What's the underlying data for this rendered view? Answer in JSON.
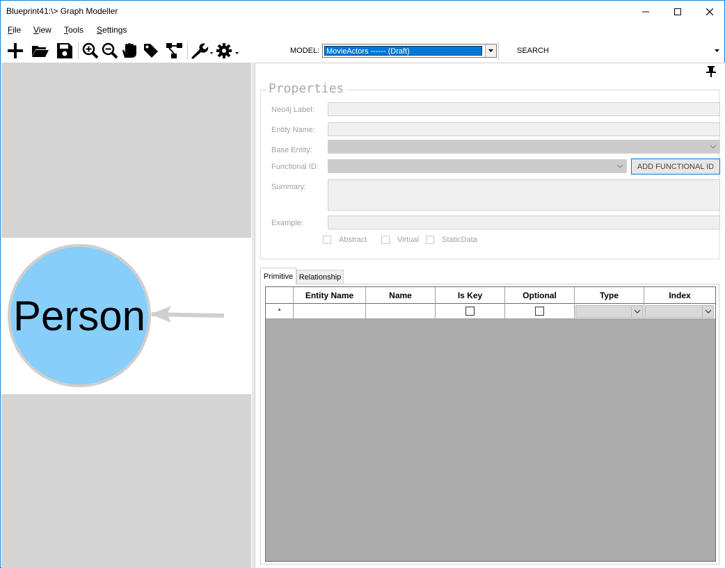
{
  "window": {
    "title": "Blueprint41:\\> Graph Modeller"
  },
  "menu": {
    "items": [
      "File",
      "View",
      "Tools",
      "Settings"
    ]
  },
  "toolbar": {
    "buttons": [
      "add-icon",
      "open-folder-icon",
      "save-icon",
      "zoom-in-icon",
      "zoom-out-icon",
      "pan-hand-icon",
      "tag-icon",
      "hierarchy-icon",
      "wrench-dropdown-icon",
      "gear-dropdown-icon"
    ],
    "model_label": "MODEL:",
    "model_value": "MovieActors ------ (Draft)",
    "search_label": "SEARCH"
  },
  "diagram": {
    "node_label": "Person",
    "node_color": "#87cefa"
  },
  "properties": {
    "title": "Properties",
    "neo4j_label": "Neo4j Label:",
    "entity_name": "Entity Name:",
    "base_entity": "Base Entity:",
    "functional_id": "Functional ID:",
    "add_functional_id": "ADD FUNCTIONAL ID",
    "summary": "Summary:",
    "example": "Example:",
    "checkboxes": [
      "Abstract",
      "Virtual",
      "StaticData"
    ]
  },
  "tabs": [
    "Primitive",
    "Relationship"
  ],
  "grid": {
    "columns": [
      "Entity Name",
      "Name",
      "Is Key",
      "Optional",
      "Type",
      "Index"
    ],
    "new_row_marker": "*"
  },
  "colors": {
    "accent": "#0078d7",
    "grid_background": "#ababab",
    "panel_gray": "#d4d4d4"
  }
}
